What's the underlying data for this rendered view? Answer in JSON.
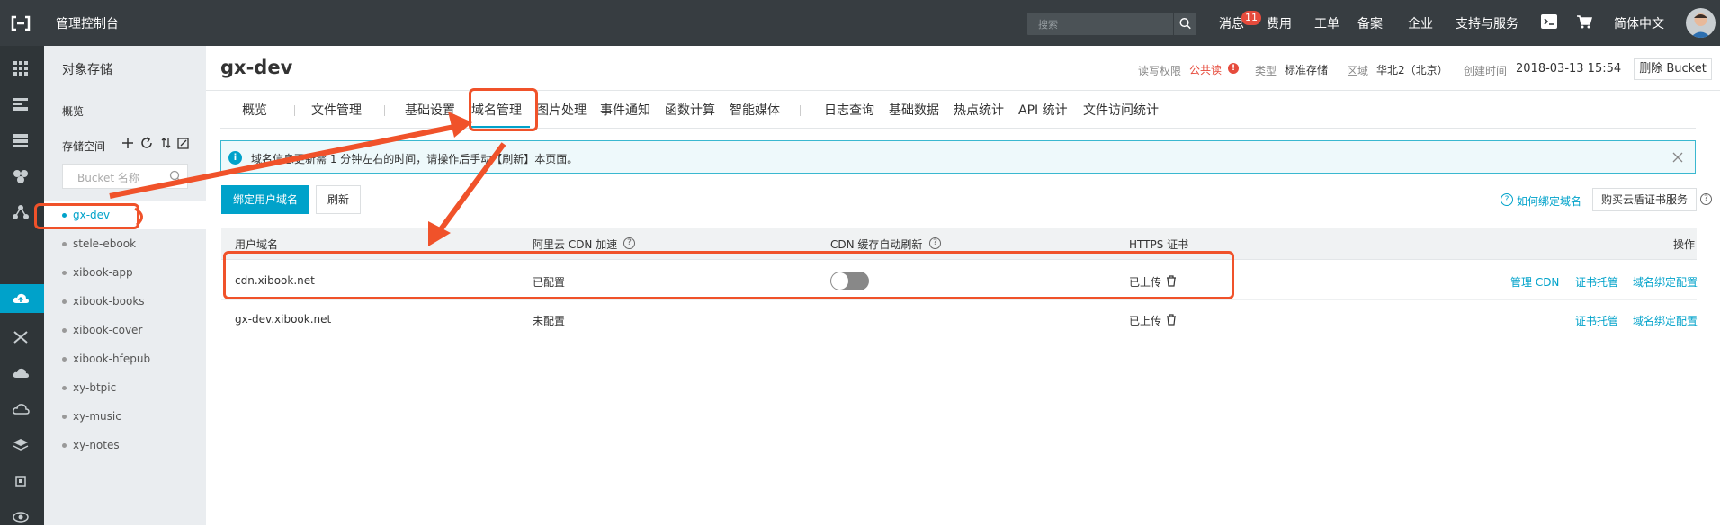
{
  "topbar": {
    "title": "管理控制台",
    "search_placeholder": "搜索",
    "messages_label": "消息",
    "messages_count": "11",
    "nav": [
      "费用",
      "工单",
      "备案",
      "企业",
      "支持与服务",
      "简体中文"
    ]
  },
  "sidebar": {
    "title": "对象存储",
    "overview": "概览",
    "space_label": "存储空间",
    "search_placeholder": "Bucket 名称",
    "buckets": [
      "gx-dev",
      "stele-ebook",
      "xibook-app",
      "xibook-books",
      "xibook-cover",
      "xibook-hfepub",
      "xy-btpic",
      "xy-music",
      "xy-notes"
    ],
    "active_bucket": "gx-dev"
  },
  "header": {
    "bucket_name": "gx-dev",
    "acl_label": "读写权限",
    "acl_value": "公共读",
    "type_label": "类型",
    "type_value": "标准存储",
    "region_label": "区域",
    "region_value": "华北2（北京）",
    "created_label": "创建时间",
    "created_value": "2018-03-13 15:54",
    "delete_button": "删除 Bucket"
  },
  "tabs": [
    "概览",
    "文件管理",
    "基础设置",
    "域名管理",
    "图片处理",
    "事件通知",
    "函数计算",
    "智能媒体",
    "日志查询",
    "基础数据",
    "热点统计",
    "API 统计",
    "文件访问统计"
  ],
  "active_tab": "域名管理",
  "notice": {
    "text": "域名信息更新需 1 分钟左右的时间，请操作后手动【刷新】本页面。"
  },
  "toolbar": {
    "bind_button": "绑定用户域名",
    "refresh_button": "刷新",
    "help_link": "如何绑定域名",
    "buy_button": "购买云盾证书服务"
  },
  "table": {
    "headers": [
      "用户域名",
      "阿里云 CDN 加速",
      "CDN 缓存自动刷新",
      "HTTPS 证书",
      "操作"
    ],
    "rows": [
      {
        "domain": "cdn.xibook.net",
        "cdn": "已配置",
        "auto_refresh": "off",
        "https": "已上传",
        "actions": [
          "管理 CDN",
          "证书托管",
          "域名绑定配置"
        ]
      },
      {
        "domain": "gx-dev.xibook.net",
        "cdn": "未配置",
        "auto_refresh": "",
        "https": "已上传",
        "actions": [
          "证书托管",
          "域名绑定配置"
        ]
      }
    ]
  },
  "colors": {
    "accent": "#00a2ca",
    "topbar": "#373d41",
    "annotation": "#f0522a",
    "danger": "#e64b3c"
  }
}
